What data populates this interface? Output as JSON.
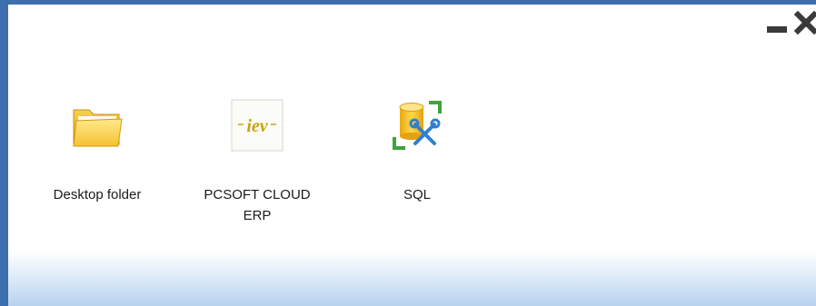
{
  "window": {
    "controls": {
      "minimize_icon": "minimize-icon",
      "close_icon": "close-icon"
    }
  },
  "icons": [
    {
      "label": "Desktop folder",
      "icon": "folder-icon"
    },
    {
      "label": "PCSOFT CLOUD ERP",
      "icon": "iev-logo-icon",
      "logo_text": "iev"
    },
    {
      "label": "SQL",
      "icon": "sql-database-tools-icon"
    }
  ],
  "colors": {
    "border": "#3d6fae",
    "folder": "#f5c232",
    "logo_text": "#c8a414",
    "sql_cylinder": "#f2c230",
    "sql_tools": "#2f7fd0",
    "sql_corners": "#3ea33a"
  }
}
